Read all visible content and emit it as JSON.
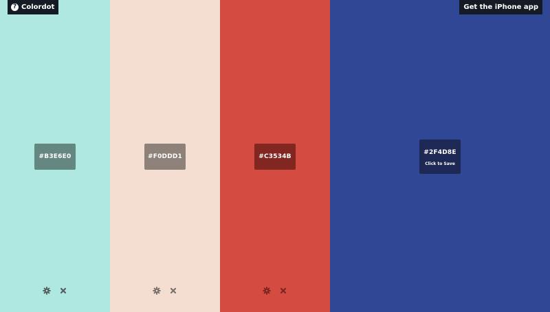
{
  "header": {
    "brand_label": "Colordot",
    "brand_icon": "question-icon",
    "app_link_label": "Get the iPhone app"
  },
  "palette": [
    {
      "hex": "#B3E6E0",
      "color": "#aee8e1",
      "settings_icon": "gear-icon",
      "remove_icon": "close-icon"
    },
    {
      "hex": "#F0DDD1",
      "color": "#f3ded1",
      "settings_icon": "gear-icon",
      "remove_icon": "close-icon"
    },
    {
      "hex": "#C3534B",
      "color": "#d44b41",
      "settings_icon": "gear-icon",
      "remove_icon": "close-icon"
    }
  ],
  "active_swatch": {
    "hex": "#2F4D8E",
    "color": "#2f4794",
    "save_label": "Click to Save"
  }
}
